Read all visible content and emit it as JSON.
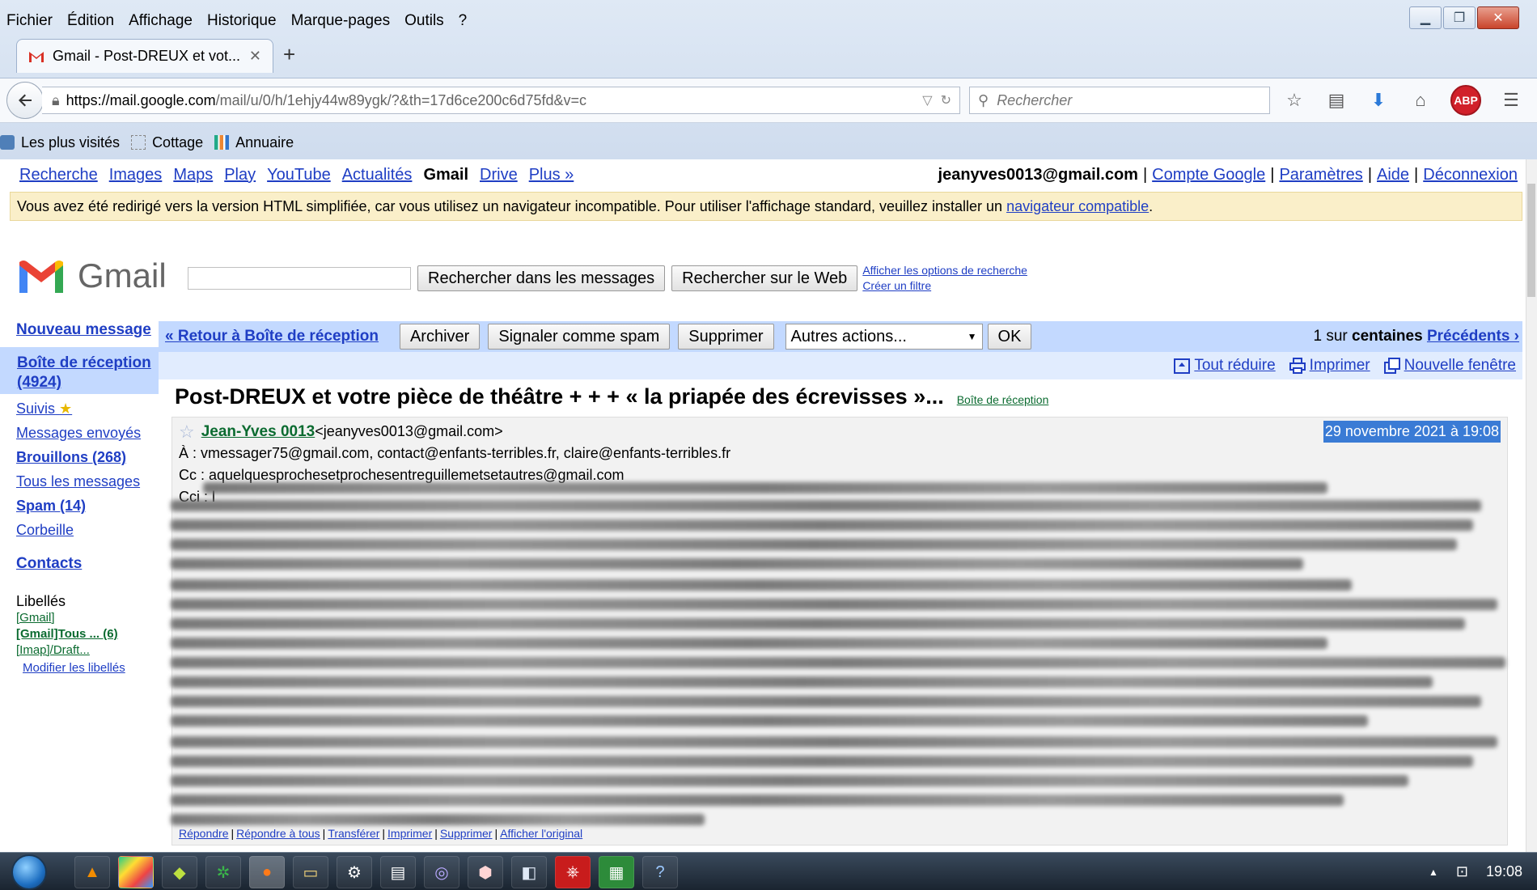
{
  "browser": {
    "menu": [
      "Fichier",
      "Édition",
      "Affichage",
      "Historique",
      "Marque-pages",
      "Outils",
      "?"
    ],
    "tab_title": "Gmail - Post-DREUX et vot...",
    "url_host": "https://mail.google.com",
    "url_rest": "/mail/u/0/h/1ehjy44w89ygk/?&th=17d6ce200c6d75fd&v=c",
    "search_placeholder": "Rechercher",
    "abp_label": "ABP",
    "bookmarks": [
      "Les plus visités",
      "Cottage",
      "Annuaire"
    ]
  },
  "gbar": {
    "links": [
      "Recherche",
      "Images",
      "Maps",
      "Play",
      "YouTube",
      "Actualités"
    ],
    "current": "Gmail",
    "links_after": [
      "Drive",
      "Plus »"
    ],
    "email": "jeanyves0013@gmail.com",
    "account_links": [
      "Compte Google",
      "Paramètres",
      "Aide",
      "Déconnexion"
    ]
  },
  "banner": {
    "text": "Vous avez été redirigé vers la version HTML simplifiée, car vous utilisez un navigateur incompatible. Pour utiliser l'affichage standard, veuillez installer un ",
    "link": "navigateur compatible",
    "end": "."
  },
  "search": {
    "wordmark": "Gmail",
    "btn_messages": "Rechercher dans les messages",
    "btn_web": "Rechercher sur le Web",
    "link_options": "Afficher les options de recherche",
    "link_filter": "Créer un filtre"
  },
  "sidebar": {
    "compose": "Nouveau message",
    "inbox": "Boîte de réception (4924)",
    "items": [
      {
        "label": "Suivis",
        "bold": false
      },
      {
        "label": "Messages envoyés",
        "bold": false
      },
      {
        "label": "Brouillons (268)",
        "bold": true
      },
      {
        "label": "Tous les messages",
        "bold": false
      },
      {
        "label": "Spam (14)",
        "bold": true
      },
      {
        "label": "Corbeille",
        "bold": false
      }
    ],
    "contacts": "Contacts",
    "labels_heading": "Libellés",
    "labels": [
      "[Gmail]",
      "[Gmail]Tous ... (6)",
      "[Imap]/Draft..."
    ],
    "modify_labels": "Modifier les libellés"
  },
  "actions": {
    "back": "« Retour à Boîte de réception",
    "archive": "Archiver",
    "spam": "Signaler comme spam",
    "delete": "Supprimer",
    "more_selected": "Autres actions...",
    "ok": "OK",
    "count_prefix": "1 sur",
    "count_bold": "centaines",
    "prev": "Précédents ›"
  },
  "tools": [
    "Tout réduire",
    "Imprimer",
    "Nouvelle fenêtre"
  ],
  "message": {
    "subject": "Post-DREUX et votre pièce de théâtre + + + « la priapée des écrevisses »...",
    "label": "Boîte de réception",
    "sender_name": "Jean-Yves 0013",
    "sender_email": "<jeanyves0013@gmail.com>",
    "date": "29 novembre 2021 à 19:08",
    "to": "À : vmessager75@gmail.com, contact@enfants-terribles.fr, claire@enfants-terribles.fr",
    "cc": "Cc : aquelquesprochesetprochesentreguillemetsetautres@gmail.com",
    "bcc": "Cci : l",
    "footer_links": [
      "Répondre",
      "Répondre à tous",
      "Transférer",
      "Imprimer",
      "Supprimer",
      "Afficher l'original"
    ]
  },
  "taskbar": {
    "clock": "19:08"
  }
}
